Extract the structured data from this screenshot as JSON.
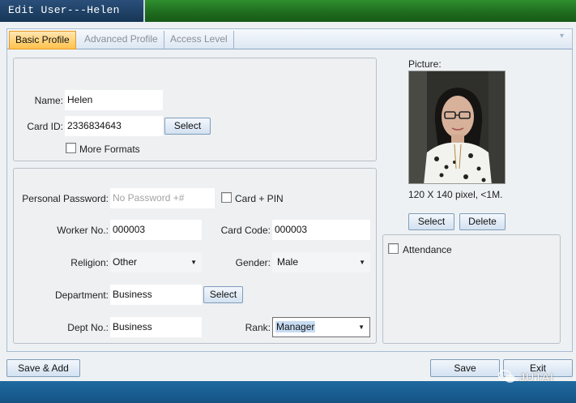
{
  "window": {
    "title": "Edit User---Helen"
  },
  "tabs": [
    {
      "label": "Basic Profile",
      "active": true
    },
    {
      "label": "Advanced Profile",
      "active": false
    },
    {
      "label": "Access Level",
      "active": false
    }
  ],
  "basic": {
    "name_label": "Name:",
    "name_value": "Helen",
    "card_id_label": "Card ID:",
    "card_id_value": "2336834643",
    "card_select_label": "Select",
    "more_formats_label": "More Formats"
  },
  "details": {
    "password_label": "Personal Password:",
    "password_placeholder": "No Password +#",
    "card_pin_label": "Card + PIN",
    "worker_no_label": "Worker No.:",
    "worker_no_value": "000003",
    "card_code_label": "Card Code:",
    "card_code_value": "000003",
    "religion_label": "Religion:",
    "religion_value": "Other",
    "gender_label": "Gender:",
    "gender_value": "Male",
    "department_label": "Department:",
    "department_value": "Business",
    "department_select_label": "Select",
    "dept_no_label": "Dept No.:",
    "dept_no_value": "Business",
    "rank_label": "Rank:",
    "rank_value": "Manager"
  },
  "picture": {
    "label": "Picture:",
    "size_hint": "120 X 140 pixel, <1M.",
    "select_label": "Select",
    "delete_label": "Delete"
  },
  "attendance": {
    "label": "Attendance"
  },
  "footer": {
    "save_add_label": "Save & Add",
    "save_label": "Save",
    "exit_label": "Exit",
    "watermark": "JUTAI"
  },
  "colors": {
    "tab_active": "#ffc24d",
    "title_green": "#1f6d1f",
    "title_blue": "#173656",
    "status_blue": "#155384",
    "button_gradient": "#d3e1f1"
  },
  "icons": {
    "dropdown": "chevron-down-icon",
    "checkbox": "checkbox-icon",
    "watermark": "wechat-logo-icon"
  }
}
